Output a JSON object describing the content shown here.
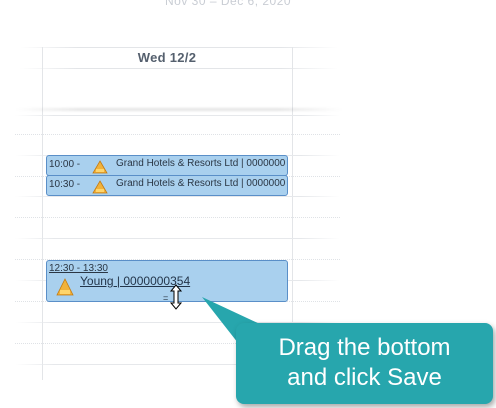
{
  "calendar": {
    "date_range_faint": "Nov 30 – Dec 6, 2020",
    "day_header": "Wed 12/2"
  },
  "events": [
    {
      "time": "10:00 -",
      "title": "Grand Hotels & Resorts Ltd | 0000000",
      "icon": "account-pyramid-icon"
    },
    {
      "time": "10:30 -",
      "title": "Grand Hotels & Resorts Ltd | 0000000",
      "icon": "account-pyramid-icon"
    }
  ],
  "selected_event": {
    "time": "12:30 - 13:30",
    "title": "Young | 0000000354",
    "icon": "account-pyramid-icon",
    "resize_handle": "="
  },
  "callout": {
    "line1": "Drag the bottom",
    "line2": "and click Save",
    "color": "#27a6ad"
  },
  "colors": {
    "event_fill": "#a9d0ee",
    "event_border": "#5a8fc8"
  }
}
